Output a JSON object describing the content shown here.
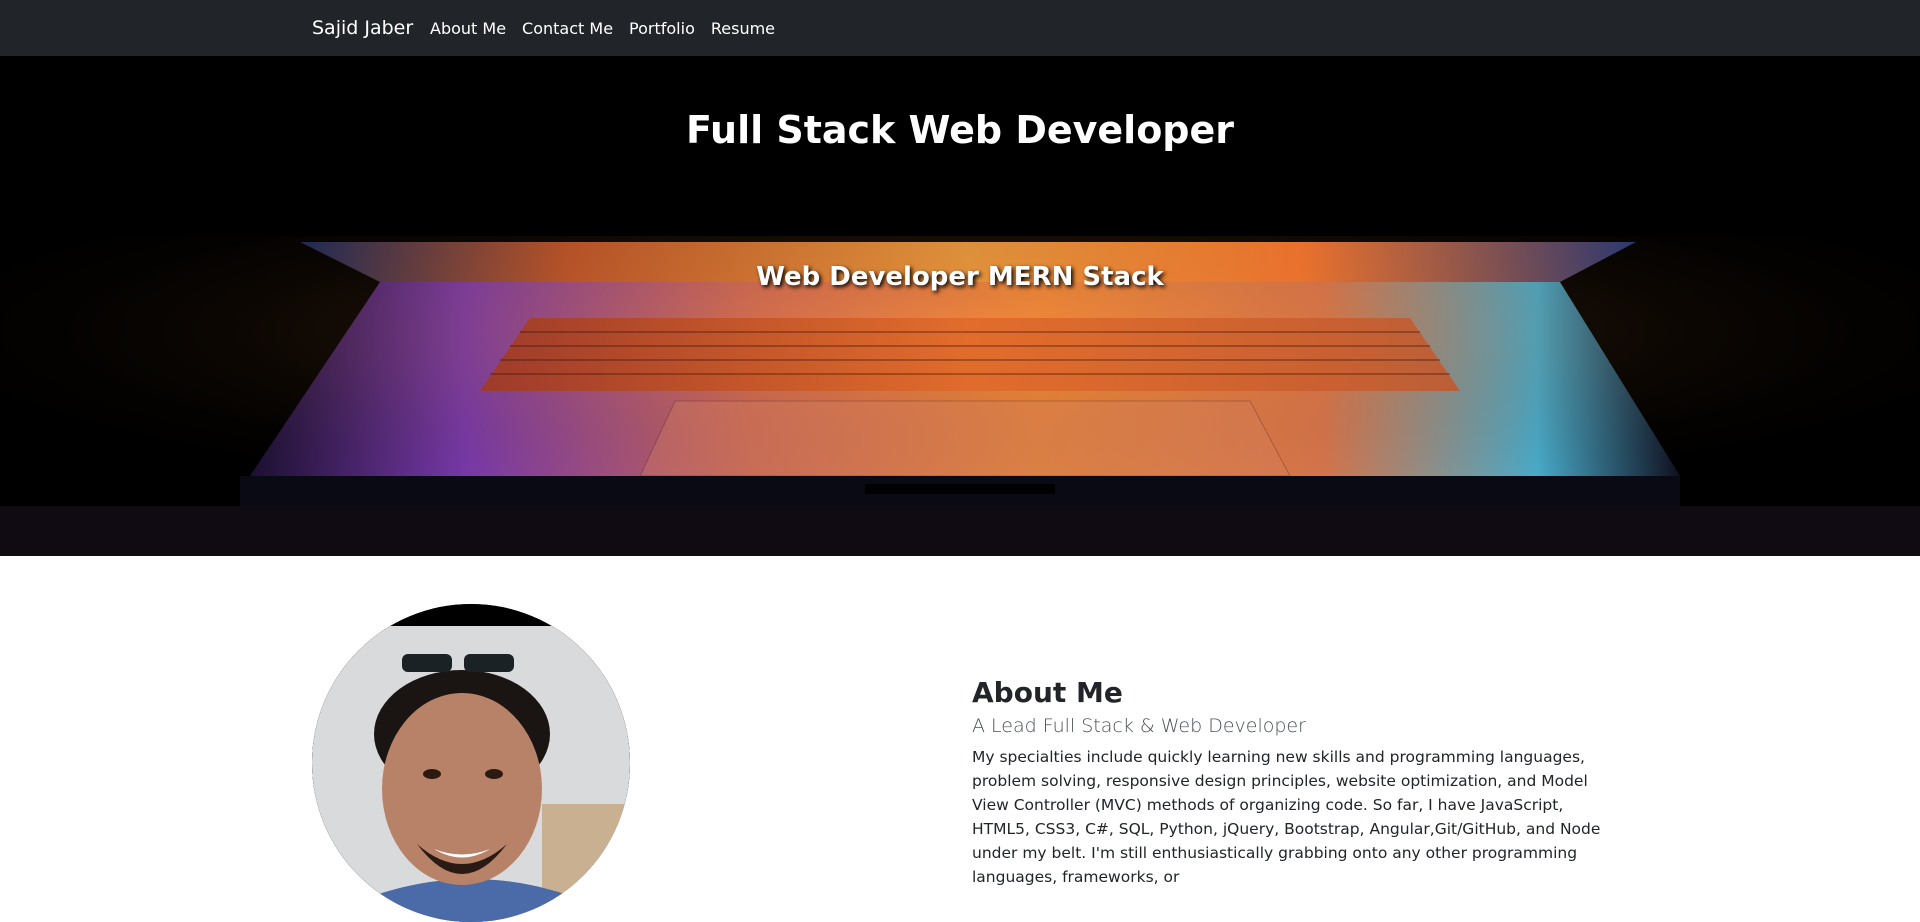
{
  "navbar": {
    "brand": "Sajid Jaber",
    "links": [
      "About Me",
      "Contact Me",
      "Portfolio",
      "Resume"
    ]
  },
  "hero": {
    "title": "Full Stack Web Developer",
    "subtitle": "Web Developer MERN Stack",
    "background_image": "laptop-photo"
  },
  "about": {
    "photo": "profile-photo",
    "heading": "About Me",
    "lead": "A Lead Full Stack & Web Developer",
    "body": "My specialties include quickly learning new skills and programming languages, problem solving, responsive design principles, website optimization, and Model View Controller (MVC) methods of organizing code. So far, I have JavaScript, HTML5, CSS3, C#, SQL, Python, jQuery, Bootstrap, Angular,Git/GitHub, and Node under my belt. I'm still enthusiastically grabbing onto any other programming languages, frameworks, or"
  },
  "colors": {
    "navbar_bg": "#212529",
    "hero_bg": "#000000",
    "text": "#212529",
    "accent_orange": "#f07a2a",
    "accent_purple": "#7a4ad0"
  }
}
